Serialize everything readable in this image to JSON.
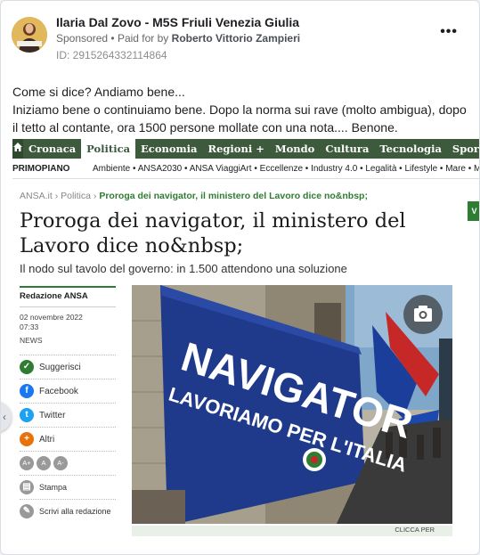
{
  "post": {
    "author": "Ilaria Dal Zovo - M5S Friuli Venezia Giulia",
    "sponsored": "Sponsored",
    "bullet": "•",
    "paid_for_by": "Paid for by",
    "payer": "Roberto Vittorio Zampieri",
    "ad_id": "ID: 2915264332114864",
    "more": "•••",
    "text_line1": "Come si dice? Andiamo bene...",
    "text_line2": "Iniziamo bene o continuiamo bene. Dopo la norma sui rave (molto ambigua), dopo il tetto al contante, ora 1500 persone mollate con una nota.... Benone."
  },
  "screenshot": {
    "nav": [
      "Cronaca",
      "Politica",
      "Economia",
      "Regioni +",
      "Mondo",
      "Cultura",
      "Tecnologia",
      "Sport"
    ],
    "nav_active": "Politica",
    "subnav_main": "PRIMOPIANO",
    "subnav_items": "Ambiente • ANSA2030 • ANSA ViaggiArt • Eccellenze • Industry 4.0 • Legalità • Lifestyle • Mare • Motori •",
    "crumb_site": "ANSA.it",
    "crumb_sep": "›",
    "crumb_section": "Politica",
    "crumb_current": "Proroga dei navigator, il ministero del Lavoro dice no&nbsp;",
    "headline": "Proroga dei navigator, il ministero del Lavoro dice no&nbsp;",
    "subhead": "Il nodo sul tavolo del governo: in 1.500 attendono una soluzione",
    "byline": "Redazione ANSA",
    "date": "02 novembre 2022",
    "time": "07:33",
    "kind": "NEWS",
    "social": [
      "Suggerisci",
      "Facebook",
      "Twitter",
      "Altri"
    ],
    "font_buttons": [
      "A+",
      "A",
      "A-"
    ],
    "print": "Stampa",
    "write": "Scrivi alla redazione",
    "banner_text1": "NAVIGATOR",
    "banner_text2": "LAVORIAMO PER L'ITALIA",
    "caption": "CLICCA PER",
    "right_tab": "V"
  },
  "colors": {
    "ansa_green": "#2e7d32",
    "nav_green": "#3d5a3d",
    "facebook": "#1877f2",
    "twitter": "#1da1f2",
    "banner_blue": "#1f3a8a"
  }
}
